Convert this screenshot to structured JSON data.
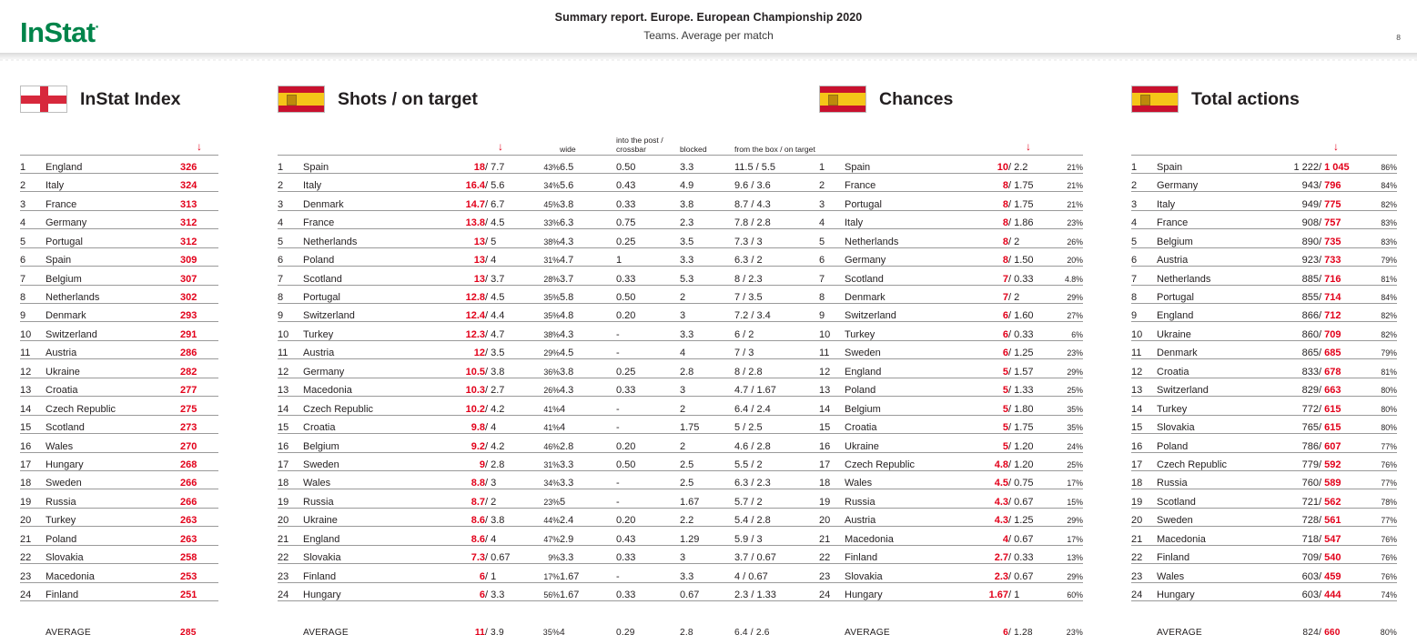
{
  "brand": {
    "name": "InStat",
    "trademark": "˙"
  },
  "header": {
    "title": "Summary report. Europe. European Championship 2020",
    "subtitle": "Teams. Average per match",
    "page_number": "8"
  },
  "colors": {
    "accent_red": "#e2001a",
    "brand_green": "#00844a",
    "text": "#231f20"
  },
  "icons": {
    "sort_desc": "↓"
  },
  "labels": {
    "average": "AVERAGE"
  },
  "columns": [
    {
      "id": "instat-index",
      "title": "InStat Index",
      "flag": "england-flag",
      "headers": [
        "",
        "",
        "↓"
      ],
      "rows": [
        {
          "rank": "1",
          "team": "England",
          "value": "326"
        },
        {
          "rank": "2",
          "team": "Italy",
          "value": "324"
        },
        {
          "rank": "3",
          "team": "France",
          "value": "313"
        },
        {
          "rank": "4",
          "team": "Germany",
          "value": "312"
        },
        {
          "rank": "5",
          "team": "Portugal",
          "value": "312"
        },
        {
          "rank": "6",
          "team": "Spain",
          "value": "309"
        },
        {
          "rank": "7",
          "team": "Belgium",
          "value": "307"
        },
        {
          "rank": "8",
          "team": "Netherlands",
          "value": "302"
        },
        {
          "rank": "9",
          "team": "Denmark",
          "value": "293"
        },
        {
          "rank": "10",
          "team": "Switzerland",
          "value": "291"
        },
        {
          "rank": "11",
          "team": "Austria",
          "value": "286"
        },
        {
          "rank": "12",
          "team": "Ukraine",
          "value": "282"
        },
        {
          "rank": "13",
          "team": "Croatia",
          "value": "277"
        },
        {
          "rank": "14",
          "team": "Czech Republic",
          "value": "275"
        },
        {
          "rank": "15",
          "team": "Scotland",
          "value": "273"
        },
        {
          "rank": "16",
          "team": "Wales",
          "value": "270"
        },
        {
          "rank": "17",
          "team": "Hungary",
          "value": "268"
        },
        {
          "rank": "18",
          "team": "Sweden",
          "value": "266"
        },
        {
          "rank": "19",
          "team": "Russia",
          "value": "266"
        },
        {
          "rank": "20",
          "team": "Turkey",
          "value": "263"
        },
        {
          "rank": "21",
          "team": "Poland",
          "value": "263"
        },
        {
          "rank": "22",
          "team": "Slovakia",
          "value": "258"
        },
        {
          "rank": "23",
          "team": "Macedonia",
          "value": "253"
        },
        {
          "rank": "24",
          "team": "Finland",
          "value": "251"
        }
      ],
      "average": {
        "team": "AVERAGE",
        "value": "285"
      }
    },
    {
      "id": "shots-on-target",
      "title": "Shots / on target",
      "flag": "spain-flag",
      "headers": {
        "main": "↓",
        "wide": "wide",
        "post": "into the post / crossbar",
        "blocked": "blocked",
        "box": "from the box / on target"
      },
      "rows": [
        {
          "rank": "1",
          "team": "Spain",
          "shots": "18",
          "on_target": "7.7",
          "pct": "43%",
          "wide": "6.5",
          "post": "0.50",
          "blocked": "3.3",
          "box": "11.5 / 5.5"
        },
        {
          "rank": "2",
          "team": "Italy",
          "shots": "16.4",
          "on_target": "5.6",
          "pct": "34%",
          "wide": "5.6",
          "post": "0.43",
          "blocked": "4.9",
          "box": "9.6 / 3.6"
        },
        {
          "rank": "3",
          "team": "Denmark",
          "shots": "14.7",
          "on_target": "6.7",
          "pct": "45%",
          "wide": "3.8",
          "post": "0.33",
          "blocked": "3.8",
          "box": "8.7 / 4.3"
        },
        {
          "rank": "4",
          "team": "France",
          "shots": "13.8",
          "on_target": "4.5",
          "pct": "33%",
          "wide": "6.3",
          "post": "0.75",
          "blocked": "2.3",
          "box": "7.8 / 2.8"
        },
        {
          "rank": "5",
          "team": "Netherlands",
          "shots": "13",
          "on_target": "5",
          "pct": "38%",
          "wide": "4.3",
          "post": "0.25",
          "blocked": "3.5",
          "box": "7.3 / 3"
        },
        {
          "rank": "6",
          "team": "Poland",
          "shots": "13",
          "on_target": "4",
          "pct": "31%",
          "wide": "4.7",
          "post": "1",
          "blocked": "3.3",
          "box": "6.3 / 2"
        },
        {
          "rank": "7",
          "team": "Scotland",
          "shots": "13",
          "on_target": "3.7",
          "pct": "28%",
          "wide": "3.7",
          "post": "0.33",
          "blocked": "5.3",
          "box": "8 / 2.3"
        },
        {
          "rank": "8",
          "team": "Portugal",
          "shots": "12.8",
          "on_target": "4.5",
          "pct": "35%",
          "wide": "5.8",
          "post": "0.50",
          "blocked": "2",
          "box": "7 / 3.5"
        },
        {
          "rank": "9",
          "team": "Switzerland",
          "shots": "12.4",
          "on_target": "4.4",
          "pct": "35%",
          "wide": "4.8",
          "post": "0.20",
          "blocked": "3",
          "box": "7.2 / 3.4"
        },
        {
          "rank": "10",
          "team": "Turkey",
          "shots": "12.3",
          "on_target": "4.7",
          "pct": "38%",
          "wide": "4.3",
          "post": "-",
          "blocked": "3.3",
          "box": "6 / 2"
        },
        {
          "rank": "11",
          "team": "Austria",
          "shots": "12",
          "on_target": "3.5",
          "pct": "29%",
          "wide": "4.5",
          "post": "-",
          "blocked": "4",
          "box": "7 / 3"
        },
        {
          "rank": "12",
          "team": "Germany",
          "shots": "10.5",
          "on_target": "3.8",
          "pct": "36%",
          "wide": "3.8",
          "post": "0.25",
          "blocked": "2.8",
          "box": "8 / 2.8"
        },
        {
          "rank": "13",
          "team": "Macedonia",
          "shots": "10.3",
          "on_target": "2.7",
          "pct": "26%",
          "wide": "4.3",
          "post": "0.33",
          "blocked": "3",
          "box": "4.7 / 1.67"
        },
        {
          "rank": "14",
          "team": "Czech Republic",
          "shots": "10.2",
          "on_target": "4.2",
          "pct": "41%",
          "wide": "4",
          "post": "-",
          "blocked": "2",
          "box": "6.4 / 2.4"
        },
        {
          "rank": "15",
          "team": "Croatia",
          "shots": "9.8",
          "on_target": "4",
          "pct": "41%",
          "wide": "4",
          "post": "-",
          "blocked": "1.75",
          "box": "5 / 2.5"
        },
        {
          "rank": "16",
          "team": "Belgium",
          "shots": "9.2",
          "on_target": "4.2",
          "pct": "46%",
          "wide": "2.8",
          "post": "0.20",
          "blocked": "2",
          "box": "4.6 / 2.8"
        },
        {
          "rank": "17",
          "team": "Sweden",
          "shots": "9",
          "on_target": "2.8",
          "pct": "31%",
          "wide": "3.3",
          "post": "0.50",
          "blocked": "2.5",
          "box": "5.5 / 2"
        },
        {
          "rank": "18",
          "team": "Wales",
          "shots": "8.8",
          "on_target": "3",
          "pct": "34%",
          "wide": "3.3",
          "post": "-",
          "blocked": "2.5",
          "box": "6.3 / 2.3"
        },
        {
          "rank": "19",
          "team": "Russia",
          "shots": "8.7",
          "on_target": "2",
          "pct": "23%",
          "wide": "5",
          "post": "-",
          "blocked": "1.67",
          "box": "5.7 / 2"
        },
        {
          "rank": "20",
          "team": "Ukraine",
          "shots": "8.6",
          "on_target": "3.8",
          "pct": "44%",
          "wide": "2.4",
          "post": "0.20",
          "blocked": "2.2",
          "box": "5.4 / 2.8"
        },
        {
          "rank": "21",
          "team": "England",
          "shots": "8.6",
          "on_target": "4",
          "pct": "47%",
          "wide": "2.9",
          "post": "0.43",
          "blocked": "1.29",
          "box": "5.9 / 3"
        },
        {
          "rank": "22",
          "team": "Slovakia",
          "shots": "7.3",
          "on_target": "0.67",
          "pct": "9%",
          "wide": "3.3",
          "post": "0.33",
          "blocked": "3",
          "box": "3.7 / 0.67"
        },
        {
          "rank": "23",
          "team": "Finland",
          "shots": "6",
          "on_target": "1",
          "pct": "17%",
          "wide": "1.67",
          "post": "-",
          "blocked": "3.3",
          "box": "4 / 0.67"
        },
        {
          "rank": "24",
          "team": "Hungary",
          "shots": "6",
          "on_target": "3.3",
          "pct": "56%",
          "wide": "1.67",
          "post": "0.33",
          "blocked": "0.67",
          "box": "2.3 / 1.33"
        }
      ],
      "average": {
        "team": "AVERAGE",
        "shots": "11",
        "on_target": "3.9",
        "pct": "35%",
        "wide": "4",
        "post": "0.29",
        "blocked": "2.8",
        "box": "6.4 / 2.6"
      }
    },
    {
      "id": "chances",
      "title": "Chances",
      "flag": "spain-flag",
      "headers": {
        "main": "↓"
      },
      "rows": [
        {
          "rank": "1",
          "team": "Spain",
          "chances": "10",
          "converted": "2.2",
          "pct": "21%"
        },
        {
          "rank": "2",
          "team": "France",
          "chances": "8",
          "converted": "1.75",
          "pct": "21%"
        },
        {
          "rank": "3",
          "team": "Portugal",
          "chances": "8",
          "converted": "1.75",
          "pct": "21%"
        },
        {
          "rank": "4",
          "team": "Italy",
          "chances": "8",
          "converted": "1.86",
          "pct": "23%"
        },
        {
          "rank": "5",
          "team": "Netherlands",
          "chances": "8",
          "converted": "2",
          "pct": "26%"
        },
        {
          "rank": "6",
          "team": "Germany",
          "chances": "8",
          "converted": "1.50",
          "pct": "20%"
        },
        {
          "rank": "7",
          "team": "Scotland",
          "chances": "7",
          "converted": "0.33",
          "pct": "4.8%"
        },
        {
          "rank": "8",
          "team": "Denmark",
          "chances": "7",
          "converted": "2",
          "pct": "29%"
        },
        {
          "rank": "9",
          "team": "Switzerland",
          "chances": "6",
          "converted": "1.60",
          "pct": "27%"
        },
        {
          "rank": "10",
          "team": "Turkey",
          "chances": "6",
          "converted": "0.33",
          "pct": "6%"
        },
        {
          "rank": "11",
          "team": "Sweden",
          "chances": "6",
          "converted": "1.25",
          "pct": "23%"
        },
        {
          "rank": "12",
          "team": "England",
          "chances": "5",
          "converted": "1.57",
          "pct": "29%"
        },
        {
          "rank": "13",
          "team": "Poland",
          "chances": "5",
          "converted": "1.33",
          "pct": "25%"
        },
        {
          "rank": "14",
          "team": "Belgium",
          "chances": "5",
          "converted": "1.80",
          "pct": "35%"
        },
        {
          "rank": "15",
          "team": "Croatia",
          "chances": "5",
          "converted": "1.75",
          "pct": "35%"
        },
        {
          "rank": "16",
          "team": "Ukraine",
          "chances": "5",
          "converted": "1.20",
          "pct": "24%"
        },
        {
          "rank": "17",
          "team": "Czech Republic",
          "chances": "4.8",
          "converted": "1.20",
          "pct": "25%"
        },
        {
          "rank": "18",
          "team": "Wales",
          "chances": "4.5",
          "converted": "0.75",
          "pct": "17%"
        },
        {
          "rank": "19",
          "team": "Russia",
          "chances": "4.3",
          "converted": "0.67",
          "pct": "15%"
        },
        {
          "rank": "20",
          "team": "Austria",
          "chances": "4.3",
          "converted": "1.25",
          "pct": "29%"
        },
        {
          "rank": "21",
          "team": "Macedonia",
          "chances": "4",
          "converted": "0.67",
          "pct": "17%"
        },
        {
          "rank": "22",
          "team": "Finland",
          "chances": "2.7",
          "converted": "0.33",
          "pct": "13%"
        },
        {
          "rank": "23",
          "team": "Slovakia",
          "chances": "2.3",
          "converted": "0.67",
          "pct": "29%"
        },
        {
          "rank": "24",
          "team": "Hungary",
          "chances": "1.67",
          "converted": "1",
          "pct": "60%"
        }
      ],
      "average": {
        "team": "AVERAGE",
        "chances": "6",
        "converted": "1.28",
        "pct": "23%"
      }
    },
    {
      "id": "total-actions",
      "title": "Total actions",
      "flag": "spain-flag",
      "headers": {
        "main": "↓"
      },
      "rows": [
        {
          "rank": "1",
          "team": "Spain",
          "total": "1 222",
          "successful": "1 045",
          "pct": "86%"
        },
        {
          "rank": "2",
          "team": "Germany",
          "total": "943",
          "successful": "796",
          "pct": "84%"
        },
        {
          "rank": "3",
          "team": "Italy",
          "total": "949",
          "successful": "775",
          "pct": "82%"
        },
        {
          "rank": "4",
          "team": "France",
          "total": "908",
          "successful": "757",
          "pct": "83%"
        },
        {
          "rank": "5",
          "team": "Belgium",
          "total": "890",
          "successful": "735",
          "pct": "83%"
        },
        {
          "rank": "6",
          "team": "Austria",
          "total": "923",
          "successful": "733",
          "pct": "79%"
        },
        {
          "rank": "7",
          "team": "Netherlands",
          "total": "885",
          "successful": "716",
          "pct": "81%"
        },
        {
          "rank": "8",
          "team": "Portugal",
          "total": "855",
          "successful": "714",
          "pct": "84%"
        },
        {
          "rank": "9",
          "team": "England",
          "total": "866",
          "successful": "712",
          "pct": "82%"
        },
        {
          "rank": "10",
          "team": "Ukraine",
          "total": "860",
          "successful": "709",
          "pct": "82%"
        },
        {
          "rank": "11",
          "team": "Denmark",
          "total": "865",
          "successful": "685",
          "pct": "79%"
        },
        {
          "rank": "12",
          "team": "Croatia",
          "total": "833",
          "successful": "678",
          "pct": "81%"
        },
        {
          "rank": "13",
          "team": "Switzerland",
          "total": "829",
          "successful": "663",
          "pct": "80%"
        },
        {
          "rank": "14",
          "team": "Turkey",
          "total": "772",
          "successful": "615",
          "pct": "80%"
        },
        {
          "rank": "15",
          "team": "Slovakia",
          "total": "765",
          "successful": "615",
          "pct": "80%"
        },
        {
          "rank": "16",
          "team": "Poland",
          "total": "786",
          "successful": "607",
          "pct": "77%"
        },
        {
          "rank": "17",
          "team": "Czech Republic",
          "total": "779",
          "successful": "592",
          "pct": "76%"
        },
        {
          "rank": "18",
          "team": "Russia",
          "total": "760",
          "successful": "589",
          "pct": "77%"
        },
        {
          "rank": "19",
          "team": "Scotland",
          "total": "721",
          "successful": "562",
          "pct": "78%"
        },
        {
          "rank": "20",
          "team": "Sweden",
          "total": "728",
          "successful": "561",
          "pct": "77%"
        },
        {
          "rank": "21",
          "team": "Macedonia",
          "total": "718",
          "successful": "547",
          "pct": "76%"
        },
        {
          "rank": "22",
          "team": "Finland",
          "total": "709",
          "successful": "540",
          "pct": "76%"
        },
        {
          "rank": "23",
          "team": "Wales",
          "total": "603",
          "successful": "459",
          "pct": "76%"
        },
        {
          "rank": "24",
          "team": "Hungary",
          "total": "603",
          "successful": "444",
          "pct": "74%"
        }
      ],
      "average": {
        "team": "AVERAGE",
        "total": "824",
        "successful": "660",
        "pct": "80%"
      }
    }
  ]
}
